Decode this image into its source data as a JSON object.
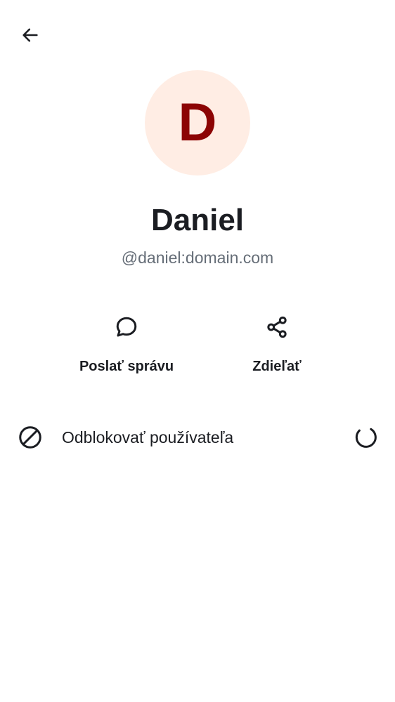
{
  "header": {
    "back_icon": "arrow-left-icon"
  },
  "profile": {
    "avatar_letter": "D",
    "avatar_bg_color": "#ffede4",
    "avatar_letter_color": "#8c0404",
    "display_name": "Daniel",
    "user_id": "@daniel:domain.com"
  },
  "actions": {
    "message": {
      "icon": "chat-bubble-icon",
      "label": "Poslať správu"
    },
    "share": {
      "icon": "share-icon",
      "label": "Zdieľať"
    }
  },
  "options": {
    "unblock": {
      "icon": "block-icon",
      "label": "Odblokovať používateľa",
      "status_icon": "loading-spinner-icon"
    }
  }
}
